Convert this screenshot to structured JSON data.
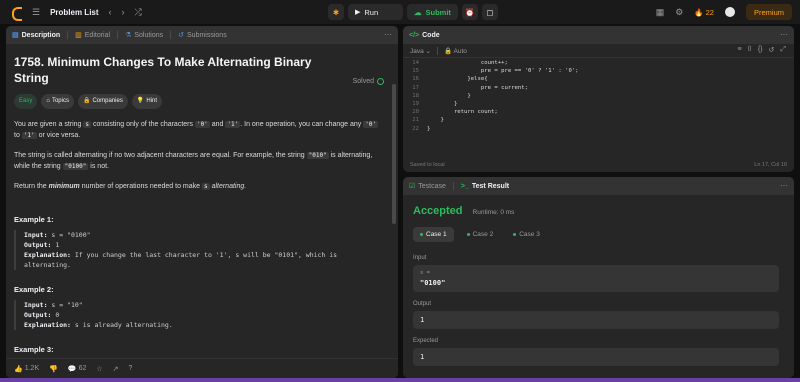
{
  "topbar": {
    "problem_list": "Problem List",
    "run": "Run",
    "submit": "Submit",
    "streak": "22",
    "premium": "Premium"
  },
  "left": {
    "tabs": {
      "description": "Description",
      "editorial": "Editorial",
      "solutions": "Solutions",
      "submissions": "Submissions"
    },
    "title": "1758. Minimum Changes To Make Alternating Binary String",
    "solved": "Solved",
    "badges": {
      "easy": "Easy",
      "topics": "Topics",
      "companies": "Companies",
      "hint": "Hint"
    },
    "p1": {
      "a": "You are given a string",
      "b": "s",
      "c": "consisting only of the characters",
      "d": "'0'",
      "e": "and",
      "f": "'1'",
      "g": ". In one operation, you can change any",
      "h": "'0'",
      "i": "to",
      "j": "'1'",
      "k": "or vice versa."
    },
    "p2": {
      "a": "The string is called alternating if no two adjacent characters are equal. For example, the string",
      "b": "\"010\"",
      "c": "is alternating, while the string",
      "d": "\"0100\"",
      "e": "is not."
    },
    "p3": {
      "a": "Return the",
      "b": "minimum",
      "c": "number of operations needed to make",
      "d": "s",
      "e": "alternating."
    },
    "ex1": {
      "title": "Example 1:",
      "input_label": "Input:",
      "input": "s = \"0100\"",
      "output_label": "Output:",
      "output": "1",
      "expl_label": "Explanation:",
      "expl": "If you change the last character to '1', s will be \"0101\", which is alternating."
    },
    "ex2": {
      "title": "Example 2:",
      "input_label": "Input:",
      "input": "s = \"10\"",
      "output_label": "Output:",
      "output": "0",
      "expl_label": "Explanation:",
      "expl": "s is already alternating."
    },
    "ex3": {
      "title": "Example 3:"
    },
    "footer": {
      "likes": "1.2K",
      "comments": "62"
    }
  },
  "code": {
    "title": "Code",
    "language": "Java",
    "mode": "Auto",
    "lines": [
      {
        "n": "14",
        "t": "                count++;"
      },
      {
        "n": "15",
        "t": "                pre = pre == '0' ? '1' : '0';"
      },
      {
        "n": "16",
        "t": "            }else{"
      },
      {
        "n": "17",
        "t": "                pre = current;"
      },
      {
        "n": "18",
        "t": "            }"
      },
      {
        "n": "19",
        "t": "        }"
      },
      {
        "n": "20",
        "t": "        return count;"
      },
      {
        "n": "21",
        "t": "    }"
      },
      {
        "n": "22",
        "t": "}"
      }
    ],
    "saved": "Saved to local",
    "cursor": "Ln 17, Col 16"
  },
  "result": {
    "tabs": {
      "testcase": "Testcase",
      "test_result": "Test Result"
    },
    "status": "Accepted",
    "runtime": "Runtime: 0 ms",
    "cases": [
      "Case 1",
      "Case 2",
      "Case 3"
    ],
    "input_label": "Input",
    "input_var": "s =",
    "input_val": "\"0100\"",
    "output_label": "Output",
    "output_val": "1",
    "expected_label": "Expected",
    "expected_val": "1"
  }
}
